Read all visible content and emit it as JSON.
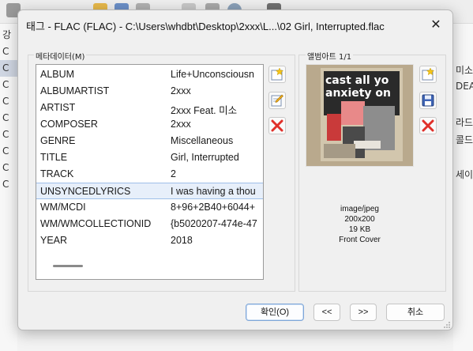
{
  "background": {
    "left_rows": [
      "강",
      "C",
      "C",
      "C",
      "C",
      "C",
      "C",
      "C",
      "C",
      "C"
    ],
    "right_rows": [
      "미소",
      "DEA",
      "라드",
      "콜드",
      "세이"
    ]
  },
  "dialog": {
    "title": "태그 - FLAC (FLAC) - C:\\Users\\whdbt\\Desktop\\2xxx\\L...\\02 Girl, Interrupted.flac",
    "close_label": "✕",
    "metadata_label": "메타데이터(M)",
    "metadata_rows": [
      {
        "key": "ALBUM",
        "value": "Life+Unconsciousn"
      },
      {
        "key": "ALBUMARTIST",
        "value": "2xxx"
      },
      {
        "key": "ARTIST",
        "value": "2xxx Feat. 미소"
      },
      {
        "key": "COMPOSER",
        "value": "2xxx"
      },
      {
        "key": "GENRE",
        "value": "Miscellaneous"
      },
      {
        "key": "TITLE",
        "value": "Girl, Interrupted"
      },
      {
        "key": "TRACK",
        "value": "2"
      },
      {
        "key": "UNSYNCEDLYRICS",
        "value": "I was having a thou"
      },
      {
        "key": "WM/MCDI",
        "value": "8+96+2B40+6044+"
      },
      {
        "key": "WM/WMCOLLECTIONID",
        "value": "{b5020207-474e-47"
      },
      {
        "key": "YEAR",
        "value": "2018"
      }
    ],
    "selected_row_index": 7,
    "albumart_label": "앨범아트 1/1",
    "albumart": {
      "cover_text_line1": "cast all yo",
      "cover_text_line2": "anxiety on",
      "mime": "image/jpeg",
      "dimensions": "200x200",
      "size": "19 KB",
      "type": "Front Cover"
    },
    "buttons": {
      "ok": "확인(O)",
      "prev": "<<",
      "next": ">>",
      "cancel": "취소"
    }
  },
  "icons": {
    "add_field": "add-star-icon",
    "edit_field": "edit-pencil-icon",
    "delete_field": "delete-x-icon",
    "add_art": "add-star-icon",
    "save_art": "floppy-save-icon",
    "delete_art": "delete-x-icon"
  },
  "colors": {
    "delete_red": "#e0302a",
    "selection_bg": "#e7effa",
    "selection_border": "#9fbfe8",
    "primary_border": "#7ea6d8"
  }
}
